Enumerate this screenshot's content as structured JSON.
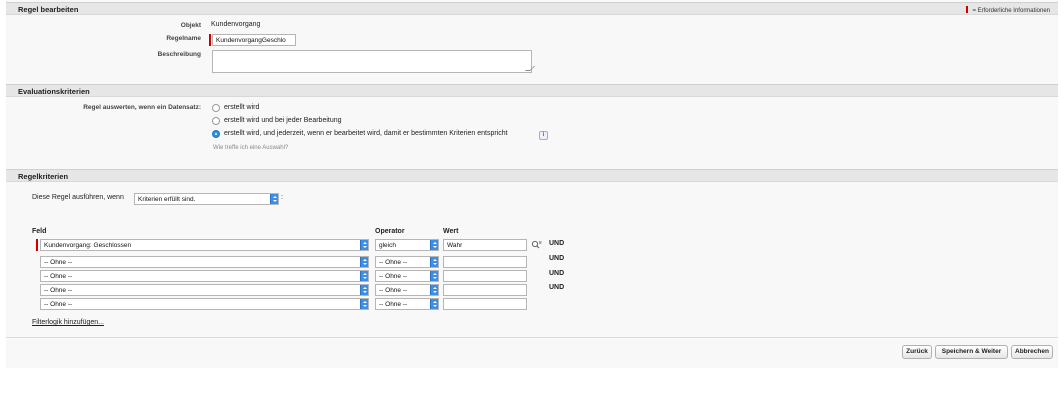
{
  "header": {
    "title": "Regel bearbeiten",
    "required_legend": "= Erforderliche Informationen"
  },
  "details": {
    "object_label": "Objekt",
    "object_value": "Kundenvorgang",
    "rule_name_label": "Regelname",
    "rule_name_value": "KundenvorgangGeschlo",
    "description_label": "Beschreibung",
    "description_value": ""
  },
  "evaluation": {
    "title": "Evaluationskriterien",
    "prompt": "Regel auswerten, wenn ein Datensatz:",
    "options": [
      {
        "label": "erstellt wird",
        "selected": false
      },
      {
        "label": "erstellt wird und bei jeder Bearbeitung",
        "selected": false
      },
      {
        "label": "erstellt wird, und jederzeit, wenn er bearbeitet wird, damit er bestimmten Kriterien entspricht",
        "selected": true
      }
    ],
    "help_link": "Wie treffe ich eine Auswahl?",
    "info_icon": "info-icon"
  },
  "criteria": {
    "title": "Regelkriterien",
    "run_prefix": "Diese Regel ausführen, wenn",
    "run_select": "Kriterien erfüllt sind.",
    "run_suffix": ":",
    "headers": {
      "field": "Feld",
      "operator": "Operator",
      "value": "Wert"
    },
    "rows": [
      {
        "field": "Kundenvorgang: Geschlossen",
        "operator": "gleich",
        "value": "Wahr",
        "connector": "UND"
      },
      {
        "field": "-- Ohne --",
        "operator": "-- Ohne --",
        "value": "",
        "connector": "UND"
      },
      {
        "field": "-- Ohne --",
        "operator": "-- Ohne --",
        "value": "",
        "connector": "UND"
      },
      {
        "field": "-- Ohne --",
        "operator": "-- Ohne --",
        "value": "",
        "connector": "UND"
      },
      {
        "field": "-- Ohne --",
        "operator": "-- Ohne --",
        "value": "",
        "connector": ""
      }
    ],
    "filter_link": "Filterlogik hinzufügen..."
  },
  "buttons": {
    "back": "Zurück",
    "save_next": "Speichern & Weiter",
    "cancel": "Abbrechen"
  },
  "colors": {
    "required": "#cc0000",
    "select_accent": "#3c8ee6",
    "section_bg": "#e6e6e6"
  }
}
